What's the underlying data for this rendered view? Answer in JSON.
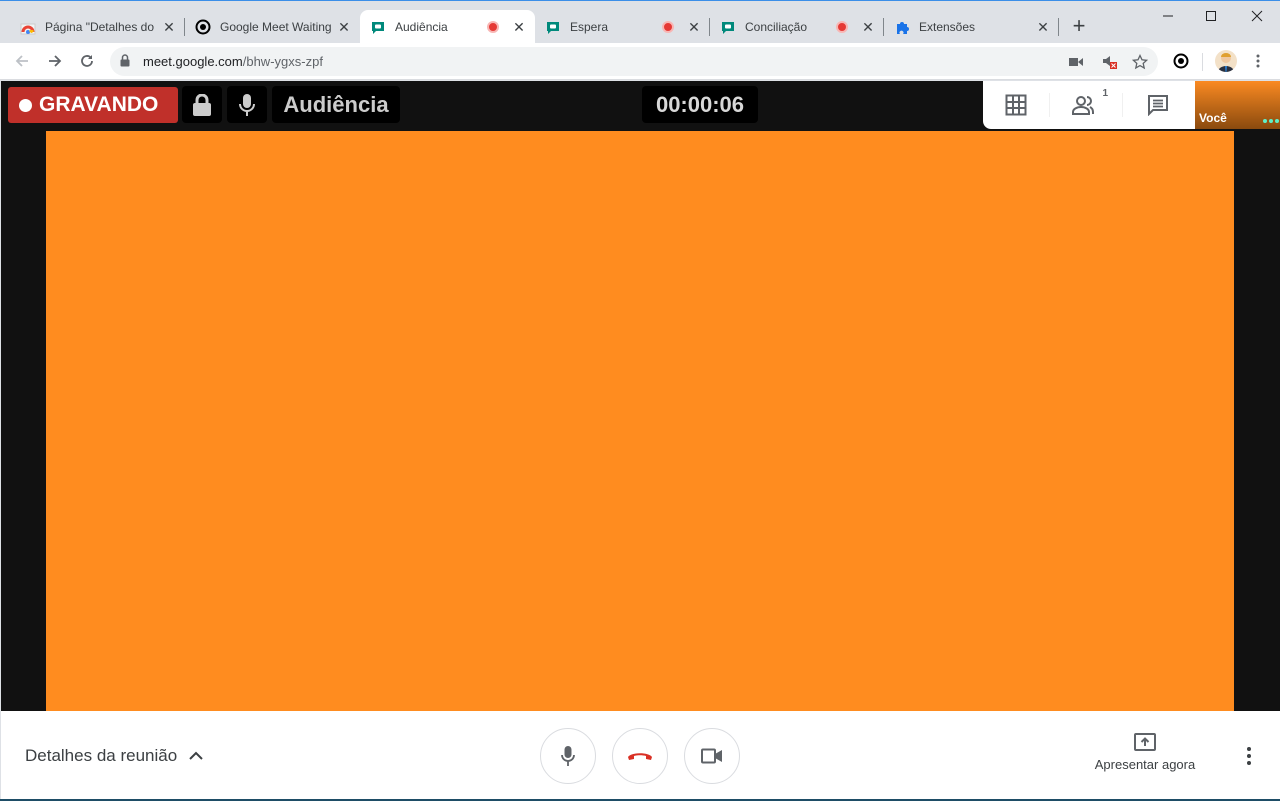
{
  "browser": {
    "tabs": [
      {
        "title": "Página \"Detalhes do",
        "favicon": "chrome-store-icon",
        "active": false,
        "recording": false
      },
      {
        "title": "Google Meet Waiting",
        "favicon": "eye-icon",
        "active": false,
        "recording": false
      },
      {
        "title": "Audiência",
        "favicon": "google-meet-icon",
        "active": true,
        "recording": true
      },
      {
        "title": "Espera",
        "favicon": "google-meet-icon",
        "active": false,
        "recording": true
      },
      {
        "title": "Conciliação",
        "favicon": "google-meet-icon",
        "active": false,
        "recording": true
      },
      {
        "title": "Extensões",
        "favicon": "puzzle-icon",
        "active": false,
        "recording": false
      }
    ],
    "new_tab_label": "+",
    "window_controls": {
      "minimize": "–",
      "maximize": "☐",
      "close": "✕"
    },
    "url_host": "meet.google.com",
    "url_path": "/bhw-ygxs-zpf"
  },
  "meet": {
    "recording_label": "GRAVANDO",
    "meeting_title": "Audiência",
    "timer": "00:00:06",
    "self_name": "Você",
    "participants_count": "1",
    "details_label": "Detalhes da reunião",
    "present_label": "Apresentar agora"
  },
  "colors": {
    "video_bg": "#ff8c1f",
    "recording_red": "#c0302a",
    "hangup_red": "#d93025",
    "meet_dark": "#111111"
  }
}
